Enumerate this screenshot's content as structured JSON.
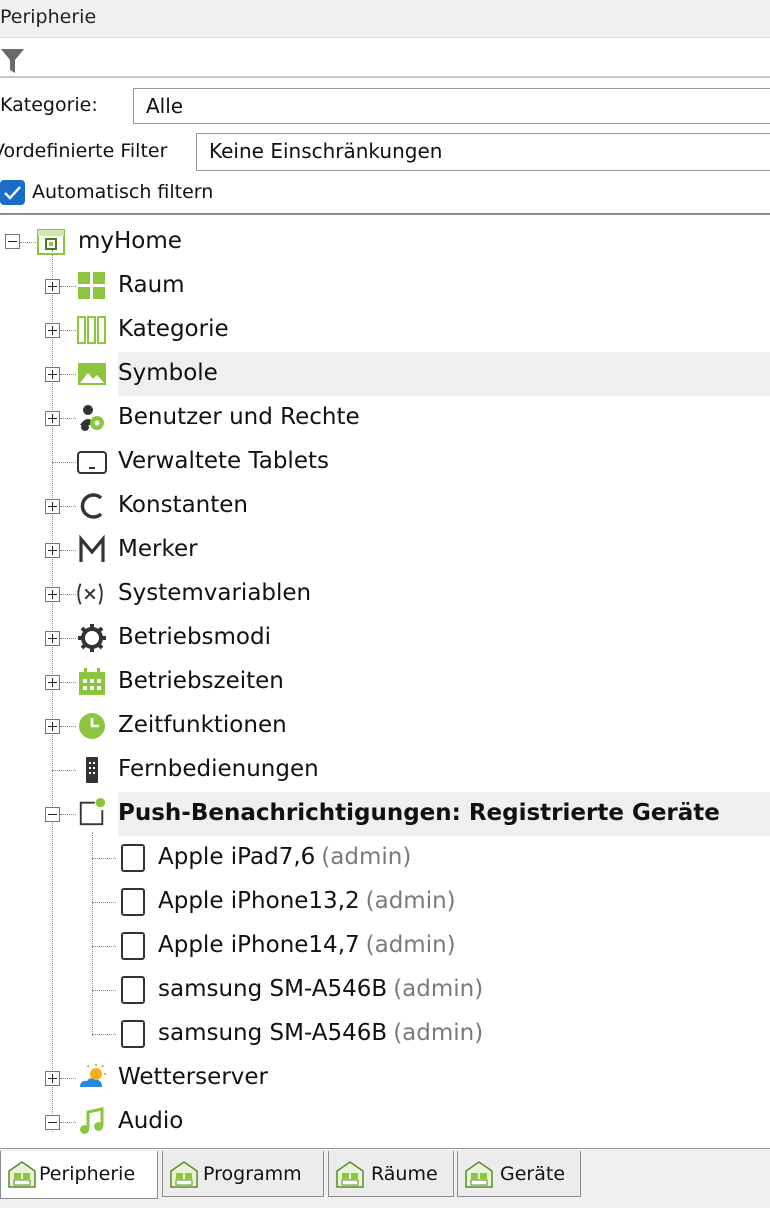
{
  "panel": {
    "title": "Peripherie"
  },
  "filter": {
    "kategorie_label": "Kategorie:",
    "kategorie_value": "Alle",
    "vordefiniert_label": "Vordefinierte Filter",
    "vordefiniert_value": "Keine Einschränkungen",
    "auto_filter_label": "Automatisch filtern",
    "auto_filter_checked": true
  },
  "tree": {
    "root": {
      "label": "myHome",
      "icon": "home-icon"
    },
    "items": [
      {
        "label": "Raum",
        "icon": "rooms-grid-icon"
      },
      {
        "label": "Kategorie",
        "icon": "category-columns-icon"
      },
      {
        "label": "Symbole",
        "icon": "image-symbol-icon"
      },
      {
        "label": "Benutzer und Rechte",
        "icon": "users-rights-icon"
      },
      {
        "label": "Verwaltete Tablets",
        "icon": "tablet-icon"
      },
      {
        "label": "Konstanten",
        "icon": "constant-c-icon"
      },
      {
        "label": "Merker",
        "icon": "marker-m-icon"
      },
      {
        "label": "Systemvariablen",
        "icon": "variable-x-icon"
      },
      {
        "label": "Betriebsmodi",
        "icon": "gear-icon"
      },
      {
        "label": "Betriebszeiten",
        "icon": "calendar-icon"
      },
      {
        "label": "Zeitfunktionen",
        "icon": "clock-icon"
      },
      {
        "label": "Fernbedienungen",
        "icon": "remote-control-icon"
      },
      {
        "label": "Push-Benachrichtigungen: Registrierte Geräte",
        "icon": "push-notification-icon"
      }
    ],
    "devices": [
      {
        "name": "Apple iPad7,6",
        "user": "(admin)"
      },
      {
        "name": "Apple iPhone13,2",
        "user": "(admin)"
      },
      {
        "name": "Apple iPhone14,7",
        "user": "(admin)"
      },
      {
        "name": "samsung SM-A546B",
        "user": "(admin)"
      },
      {
        "name": "samsung SM-A546B",
        "user": "(admin)"
      }
    ],
    "after": [
      {
        "label": "Wetterserver",
        "icon": "weather-icon"
      },
      {
        "label": "Audio",
        "icon": "music-note-icon"
      }
    ]
  },
  "tabs": [
    {
      "label": "Peripherie",
      "active": true
    },
    {
      "label": "Programm",
      "active": false
    },
    {
      "label": "Räume",
      "active": false
    },
    {
      "label": "Geräte",
      "active": false
    }
  ],
  "colors": {
    "accent_green": "#8cc63f",
    "checkbox_blue": "#1a6cc6"
  }
}
